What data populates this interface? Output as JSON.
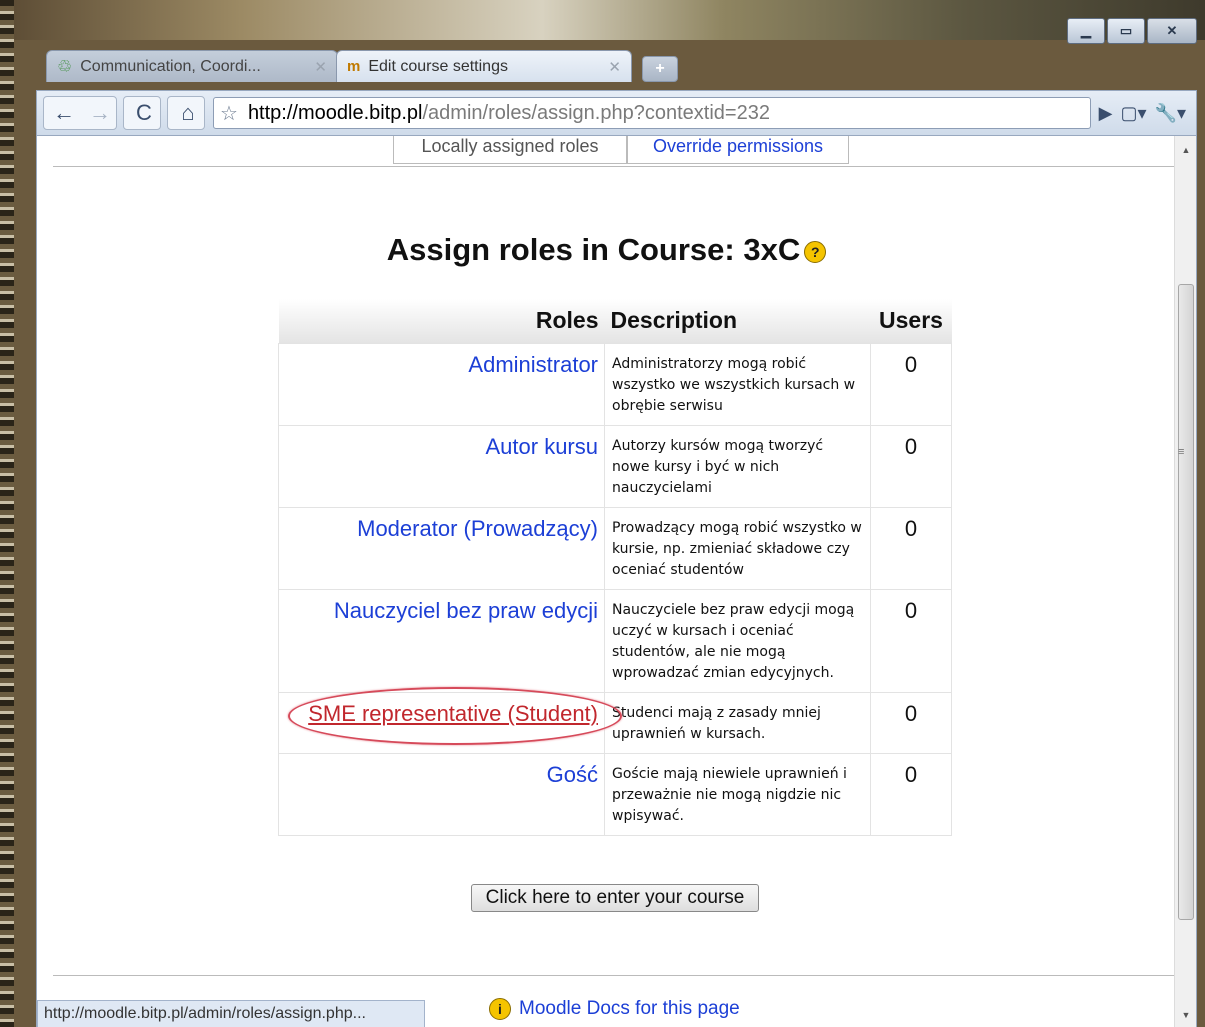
{
  "browser": {
    "tabs": [
      {
        "title": "Communication, Coordi...",
        "icon": "recycle-icon"
      },
      {
        "title": "Edit course settings",
        "icon": "moodle-icon"
      }
    ],
    "window_controls": {
      "minimize": "▁",
      "maximize": "▭",
      "close": "✕"
    },
    "url": {
      "host": "http://moodle.bitp.pl",
      "path": "/admin/roles/assign.php?contextid=232"
    },
    "status_bar": "http://moodle.bitp.pl/admin/roles/assign.php..."
  },
  "page": {
    "subtabs": [
      "Locally assigned roles",
      "Override permissions"
    ],
    "title": "Assign roles in Course: 3xC",
    "table": {
      "headers": {
        "roles": "Roles",
        "description": "Description",
        "users": "Users"
      },
      "rows": [
        {
          "role": "Administrator",
          "description": "Administratorzy mogą robić wszystko we wszystkich kursach w obrębie serwisu",
          "users": "0"
        },
        {
          "role": "Autor kursu",
          "description": "Autorzy kursów mogą tworzyć nowe kursy i być w nich nauczycielami",
          "users": "0"
        },
        {
          "role": "Moderator (Prowadzący)",
          "description": "Prowadzący mogą robić wszystko w kursie, np. zmieniać składowe czy oceniać studentów",
          "users": "0"
        },
        {
          "role": "Nauczyciel bez praw edycji",
          "description": "Nauczyciele bez praw edycji mogą uczyć w kursach i oceniać studentów, ale nie mogą wprowadzać zmian edycyjnych.",
          "users": "0"
        },
        {
          "role": "SME representative (Student)",
          "description": "Studenci mają z zasady mniej uprawnień w kursach.",
          "users": "0"
        },
        {
          "role": "Gość",
          "description": "Goście mają niewiele uprawnień i przeważnie nie mogą nigdzie nic wpisywać.",
          "users": "0"
        }
      ]
    },
    "enter_button": "Click here to enter your course",
    "docs_link": "Moodle Docs for this page"
  },
  "colors": {
    "link": "#1c3fd6",
    "highlight": "#c1272d"
  }
}
